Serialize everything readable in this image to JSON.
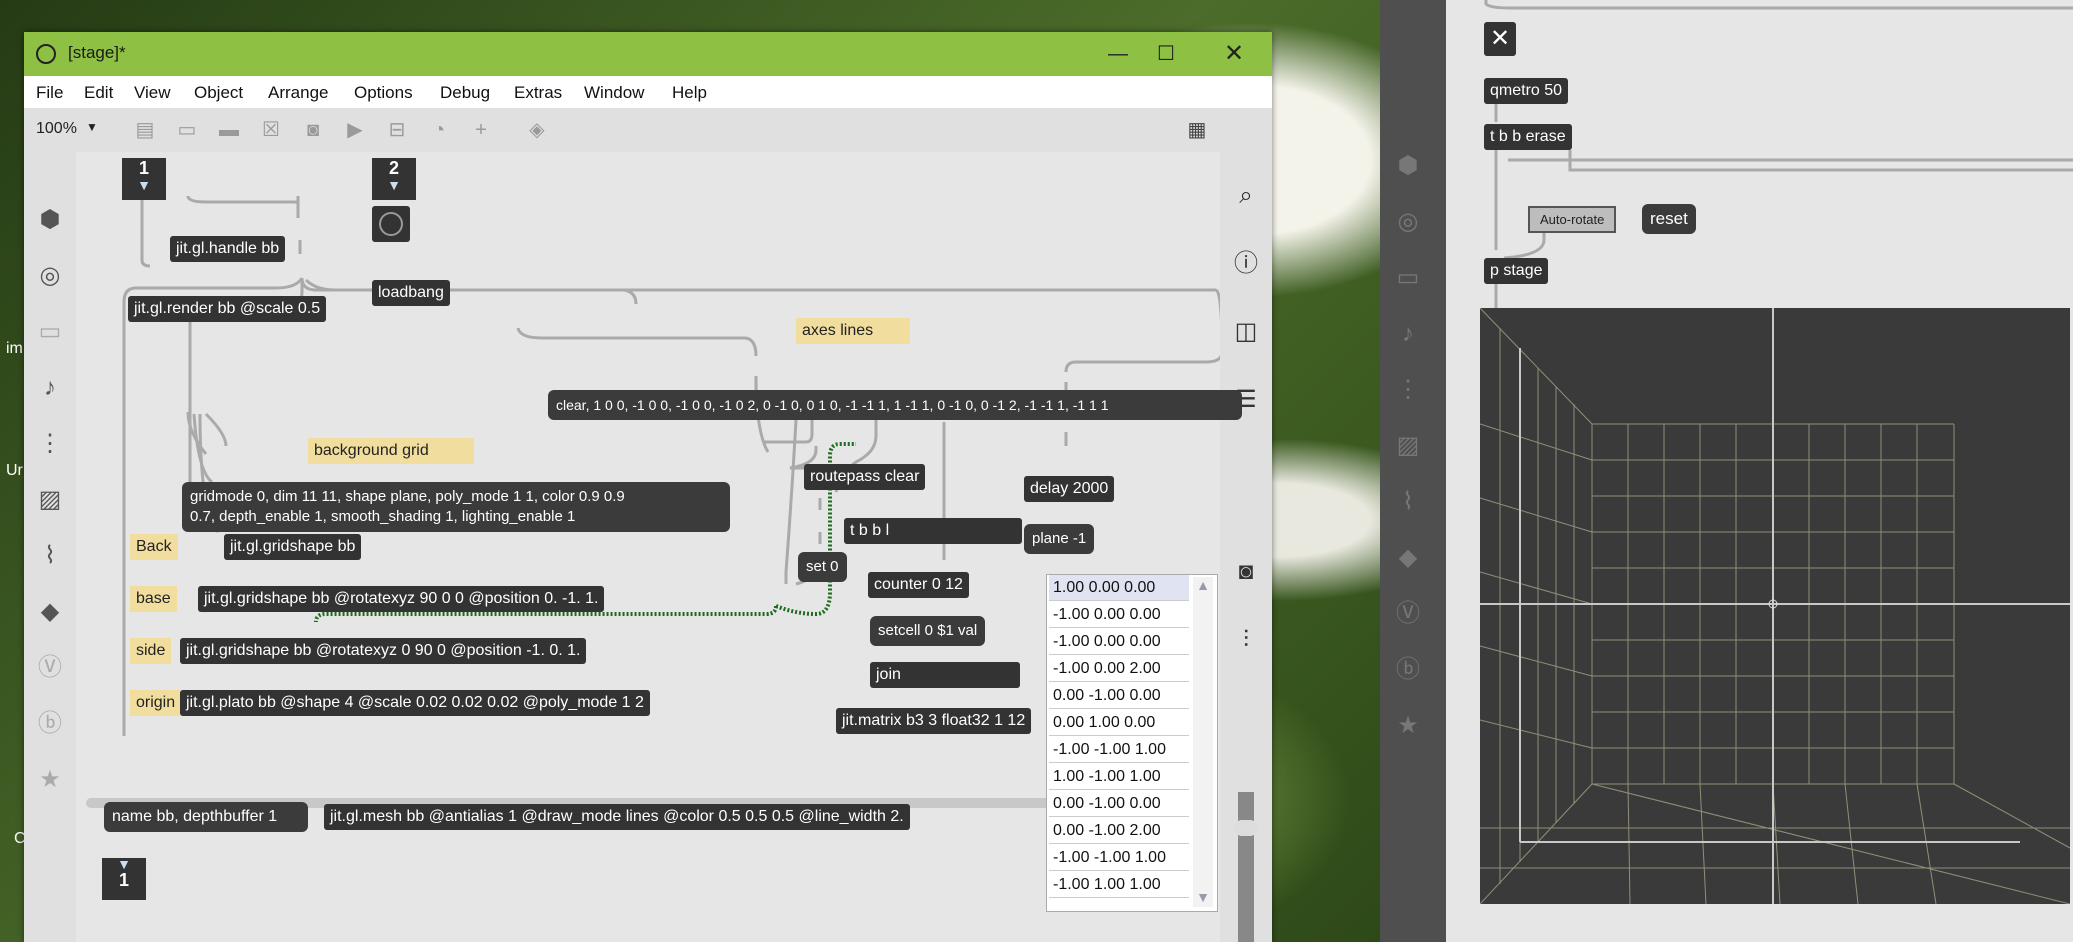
{
  "window": {
    "title": "[stage]*",
    "controls": [
      "minimize",
      "maximize",
      "close"
    ]
  },
  "menu": [
    "File",
    "Edit",
    "View",
    "Object",
    "Arrange",
    "Options",
    "Debug",
    "Extras",
    "Window",
    "Help"
  ],
  "toolbar": {
    "zoom": "100%"
  },
  "patcher": {
    "inlet1": "1",
    "inlet2": "2",
    "outlet1": "1",
    "objects": {
      "handle": "jit.gl.handle bb",
      "render": "jit.gl.render bb @scale 0.5",
      "loadbang": "loadbang",
      "routepass": "routepass clear",
      "delay": "delay 2000",
      "plane": "plane -1",
      "tbbl": "t b b l",
      "set0": "set 0",
      "counter": "counter 0 12",
      "setcell": "setcell 0 $1 val",
      "join": "join",
      "matrix": "jit.matrix b3 3 float32 1 12",
      "gridshape_back": "jit.gl.gridshape bb",
      "gridshape_base": "jit.gl.gridshape bb @rotatexyz 90 0 0 @position 0. -1. 1.",
      "gridshape_side": "jit.gl.gridshape bb @rotatexyz 0 90 0 @position -1. 0. 1.",
      "plato": "jit.gl.plato bb @shape 4 @scale 0.02 0.02 0.02 @poly_mode 1 2",
      "mesh": "jit.gl.mesh bb @antialias 1 @draw_mode lines @color 0.5 0.5 0.5 @line_width 2.",
      "namebb": "name bb, depthbuffer 1"
    },
    "messages": {
      "clear": "clear, 1 0 0, -1 0 0, -1 0 0, -1 0 2, 0 -1 0, 0 1 0, -1 -1 1, 1 -1 1, 0 -1 0, 0 -1 2, -1 -1 1, -1 1 1",
      "gridmode": "gridmode 0, dim 11 11, shape plane, poly_mode 1 1, color 0.9 0.9\n0.7, depth_enable 1, smooth_shading 1, lighting_enable 1"
    },
    "comments": {
      "axes": "axes lines",
      "bggrid": "background grid",
      "back": "Back",
      "base": "base",
      "side": "side",
      "origin": "origin"
    },
    "listbox": [
      "1.00 0.00 0.00",
      "-1.00 0.00 0.00",
      "-1.00 0.00 0.00",
      "-1.00 0.00 2.00",
      "0.00 -1.00 0.00",
      "0.00 1.00 0.00",
      "-1.00 -1.00 1.00",
      "1.00 -1.00 1.00",
      "0.00 -1.00 0.00",
      "0.00 -1.00 2.00",
      "-1.00 -1.00 1.00",
      "-1.00 1.00 1.00"
    ]
  },
  "right_panel": {
    "qmetro": "qmetro 50",
    "tbberase": "t b b erase",
    "autorotate": "Auto-rotate",
    "reset": "reset",
    "pstage": "p stage"
  },
  "colors": {
    "titlebar": "#8dc043",
    "object_bg": "#333333",
    "comment_bg": "#f1de9e",
    "grid_line": "#d9d6a8",
    "selected_cable": "#2d7a2d"
  },
  "desktop_fragments": [
    "im",
    "Ur",
    "C"
  ]
}
